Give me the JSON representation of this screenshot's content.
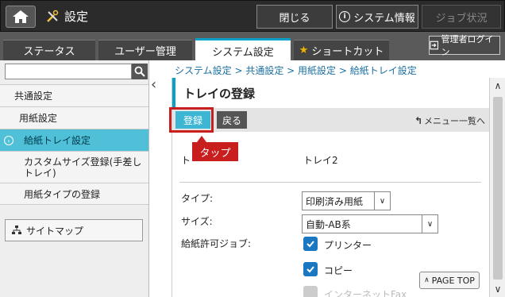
{
  "topbar": {
    "title": "設定",
    "close_label": "閉じる",
    "system_info_label": "システム情報",
    "job_status_label": "ジョブ状況"
  },
  "tabs": [
    {
      "label": "ステータス"
    },
    {
      "label": "ユーザー管理"
    },
    {
      "label": "システム設定"
    },
    {
      "label": "ショートカット"
    }
  ],
  "admin_login_label": "管理者ログイン",
  "sidebar": {
    "search_value": "",
    "items": [
      {
        "label": "共通設定"
      },
      {
        "label": "用紙設定"
      },
      {
        "label": "給紙トレイ設定"
      },
      {
        "label": "カスタムサイズ登録(手差しトレイ)"
      },
      {
        "label": "用紙タイプの登録"
      }
    ],
    "sitemap_label": "サイトマップ"
  },
  "breadcrumb": "システム設定 > 共通設定 > 用紙設定 > 給紙トレイ設定",
  "panel": {
    "title": "トレイの登録",
    "register_label": "登録",
    "back_label": "戻る",
    "menu_list_label": "メニュー一覧へ"
  },
  "annotation": {
    "tap_label": "タップ"
  },
  "form": {
    "tray_label": "ト",
    "tray_value": "トレイ2",
    "type_label": "タイプ:",
    "type_value": "印刷済み用紙",
    "size_label": "サイズ:",
    "size_value": "自動-AB系",
    "allowed_jobs_label": "給紙許可ジョブ:",
    "jobs": [
      {
        "label": "プリンター",
        "checked": true
      },
      {
        "label": "コピー",
        "checked": true
      },
      {
        "label": "インターネットFax",
        "checked": false,
        "disabled": true
      }
    ]
  },
  "pagetop_label": "PAGE TOP",
  "colors": {
    "accent": "#0aa0c8",
    "highlight": "#c81e1e",
    "active_item": "#4fc0d8"
  }
}
